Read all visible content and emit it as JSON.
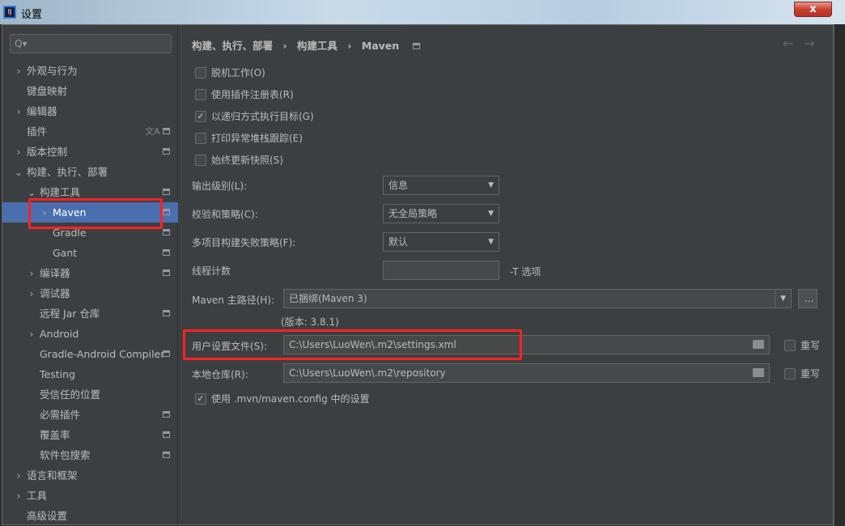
{
  "window": {
    "title": "设置",
    "close": "x"
  },
  "sidebar": {
    "search_placeholder": "Q▾",
    "items": [
      {
        "label": "外观与行为",
        "arrow": "›",
        "level": 0
      },
      {
        "label": "键盘映射",
        "arrow": "",
        "level": 0
      },
      {
        "label": "编辑器",
        "arrow": "›",
        "level": 0
      },
      {
        "label": "插件",
        "arrow": "",
        "level": 0,
        "translate": true,
        "pin": true
      },
      {
        "label": "版本控制",
        "arrow": "›",
        "level": 0,
        "pin": true
      },
      {
        "label": "构建、执行、部署",
        "arrow": "⌄",
        "level": 0
      },
      {
        "label": "构建工具",
        "arrow": "⌄",
        "level": 1,
        "pin": true
      },
      {
        "label": "Maven",
        "arrow": "›",
        "level": 2,
        "pin": true,
        "selected": true
      },
      {
        "label": "Gradle",
        "arrow": "",
        "level": 2,
        "pin": true
      },
      {
        "label": "Gant",
        "arrow": "",
        "level": 2,
        "pin": true
      },
      {
        "label": "编译器",
        "arrow": "›",
        "level": 1,
        "pin": true
      },
      {
        "label": "调试器",
        "arrow": "›",
        "level": 1
      },
      {
        "label": "远程 Jar 仓库",
        "arrow": "",
        "level": 1,
        "pin": true
      },
      {
        "label": "Android",
        "arrow": "›",
        "level": 1
      },
      {
        "label": "Gradle-Android Compiler",
        "arrow": "",
        "level": 1,
        "pin": true
      },
      {
        "label": "Testing",
        "arrow": "",
        "level": 1
      },
      {
        "label": "受信任的位置",
        "arrow": "",
        "level": 1
      },
      {
        "label": "必需插件",
        "arrow": "",
        "level": 1,
        "pin": true
      },
      {
        "label": "覆盖率",
        "arrow": "",
        "level": 1,
        "pin": true
      },
      {
        "label": "软件包搜索",
        "arrow": "",
        "level": 1,
        "pin": true
      },
      {
        "label": "语言和框架",
        "arrow": "›",
        "level": 0
      },
      {
        "label": "工具",
        "arrow": "›",
        "level": 0
      },
      {
        "label": "高级设置",
        "arrow": "",
        "level": 0
      }
    ]
  },
  "breadcrumb": [
    "构建、执行、部署",
    "›",
    "构建工具",
    "›",
    "Maven"
  ],
  "nav": {
    "back": "←",
    "forward": "→"
  },
  "checkboxes": [
    {
      "label": "脱机工作(O)",
      "checked": false
    },
    {
      "label": "使用插件注册表(R)",
      "checked": false
    },
    {
      "label": "以递归方式执行目标(G)",
      "checked": true
    },
    {
      "label": "打印异常堆栈跟踪(E)",
      "checked": false
    },
    {
      "label": "始终更新快照(S)",
      "checked": false
    }
  ],
  "form": {
    "output_level": {
      "label": "输出级别(L):",
      "value": "信息"
    },
    "checksum": {
      "label": "校验和策略(C):",
      "value": "无全局策略"
    },
    "multiproject": {
      "label": "多项目构建失败策略(F):",
      "value": "默认"
    },
    "threads": {
      "label": "线程计数",
      "value": "",
      "suffix": "-T 选项"
    },
    "maven_home": {
      "label": "Maven 主路径(H):",
      "value": "已捆绑(Maven 3)",
      "browse": "...",
      "version": "(版本: 3.8.1)"
    },
    "user_settings": {
      "label": "用户设置文件(S):",
      "value": "C:\\Users\\LuoWen\\.m2\\settings.xml",
      "override": "重写",
      "override_checked": false
    },
    "local_repo": {
      "label": "本地仓库(R):",
      "value": "C:\\Users\\LuoWen\\.m2\\repository",
      "override": "重写",
      "override_checked": false
    },
    "use_mvn_config": {
      "label": "使用 .mvn/maven.config 中的设置",
      "checked": true
    }
  },
  "colors": {
    "selection": "#4b6eaf",
    "highlight": "#ff2222",
    "background": "#3c3f41"
  }
}
